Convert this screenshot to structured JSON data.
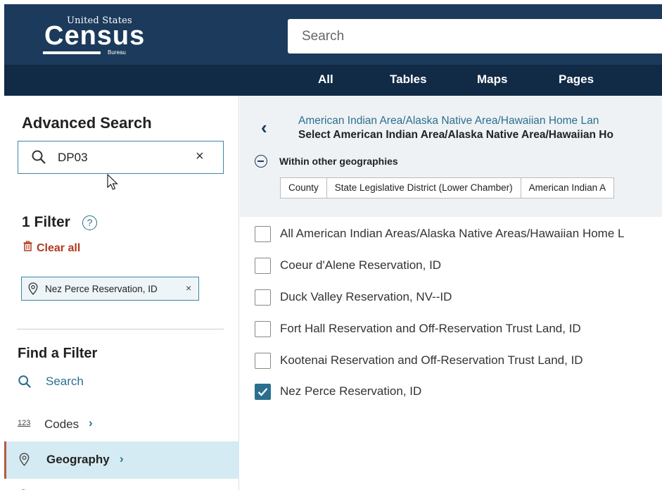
{
  "header": {
    "logo": {
      "top": "United States",
      "main": "Census",
      "bottom": "Bureau"
    },
    "search_placeholder": "Search",
    "colors": {
      "header": "#1c3a5b",
      "nav": "#112a45",
      "accent": "#2b6f8f"
    }
  },
  "nav": {
    "tabs": [
      "All",
      "Tables",
      "Maps",
      "Pages"
    ]
  },
  "sidebar": {
    "advanced_search_title": "Advanced Search",
    "search_value": "DP03",
    "filters_title": "1 Filter",
    "help_icon": "?",
    "clear_all": "Clear all",
    "chip_label": "Nez Perce Reservation, ID",
    "find_filter_title": "Find a Filter",
    "items": [
      {
        "label": "Search",
        "icon": "search-icon"
      },
      {
        "label": "Codes",
        "icon": "codes-icon",
        "icon_text": "123"
      },
      {
        "label": "Geography",
        "icon": "location-pin-icon",
        "selected": true
      }
    ]
  },
  "main": {
    "breadcrumb_link": "American Indian Area/Alaska Native Area/Hawaiian Home Lan",
    "breadcrumb_current": "Select American Indian Area/Alaska Native Area/Hawaiian Ho",
    "within_label": "Within other geographies",
    "geo_tabs": [
      "County",
      "State Legislative District (Lower Chamber)",
      "American Indian A"
    ],
    "options": [
      {
        "label": "All American Indian Areas/Alaska Native Areas/Hawaiian Home L",
        "checked": false
      },
      {
        "label": "Coeur d'Alene Reservation, ID",
        "checked": false
      },
      {
        "label": "Duck Valley Reservation, NV--ID",
        "checked": false
      },
      {
        "label": "Fort Hall Reservation and Off-Reservation Trust Land, ID",
        "checked": false
      },
      {
        "label": "Kootenai Reservation and Off-Reservation Trust Land, ID",
        "checked": false
      },
      {
        "label": "Nez Perce Reservation, ID",
        "checked": true
      }
    ]
  }
}
